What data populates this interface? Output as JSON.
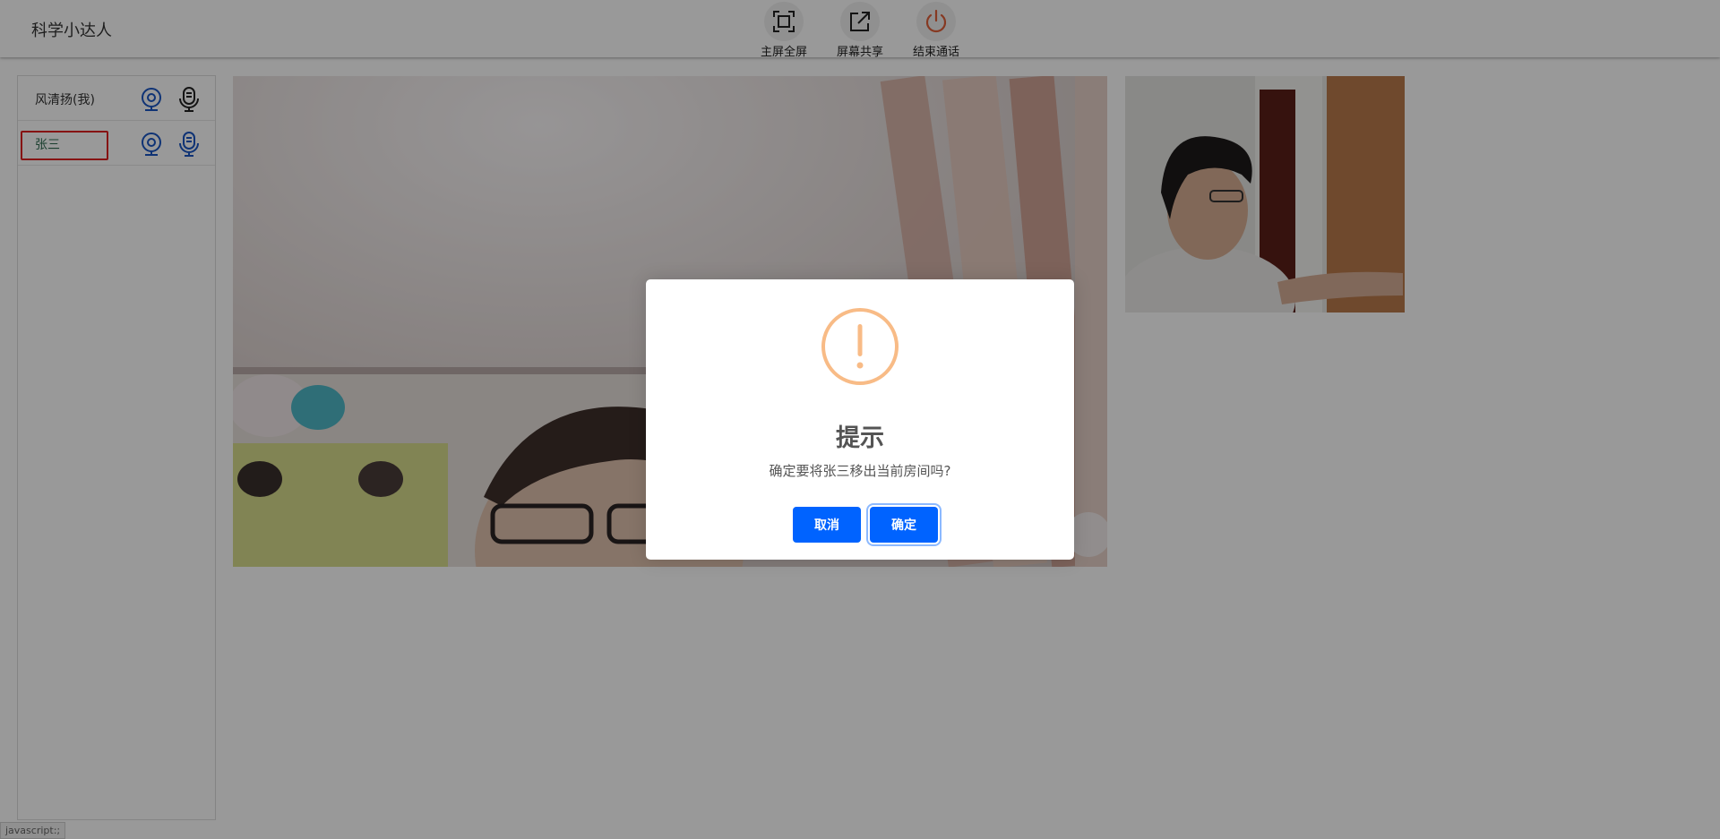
{
  "app": {
    "title": "科学小达人"
  },
  "toolbar": {
    "fullscreen_label": "主屏全屏",
    "share_label": "屏幕共享",
    "end_label": "结束通话"
  },
  "participants": [
    {
      "name": "风清扬(我)",
      "selected": false
    },
    {
      "name": "张三",
      "selected": true
    }
  ],
  "status_bar": {
    "text": "javascript:;"
  },
  "dialog": {
    "title": "提示",
    "message": "确定要将张三移出当前房间吗?",
    "cancel_label": "取消",
    "confirm_label": "确定"
  },
  "colors": {
    "accent": "#0063ff",
    "icon_blue": "#1a56c4",
    "warning": "#f8bb86",
    "end_call": "#e0603a",
    "selected_border": "#e02020"
  }
}
